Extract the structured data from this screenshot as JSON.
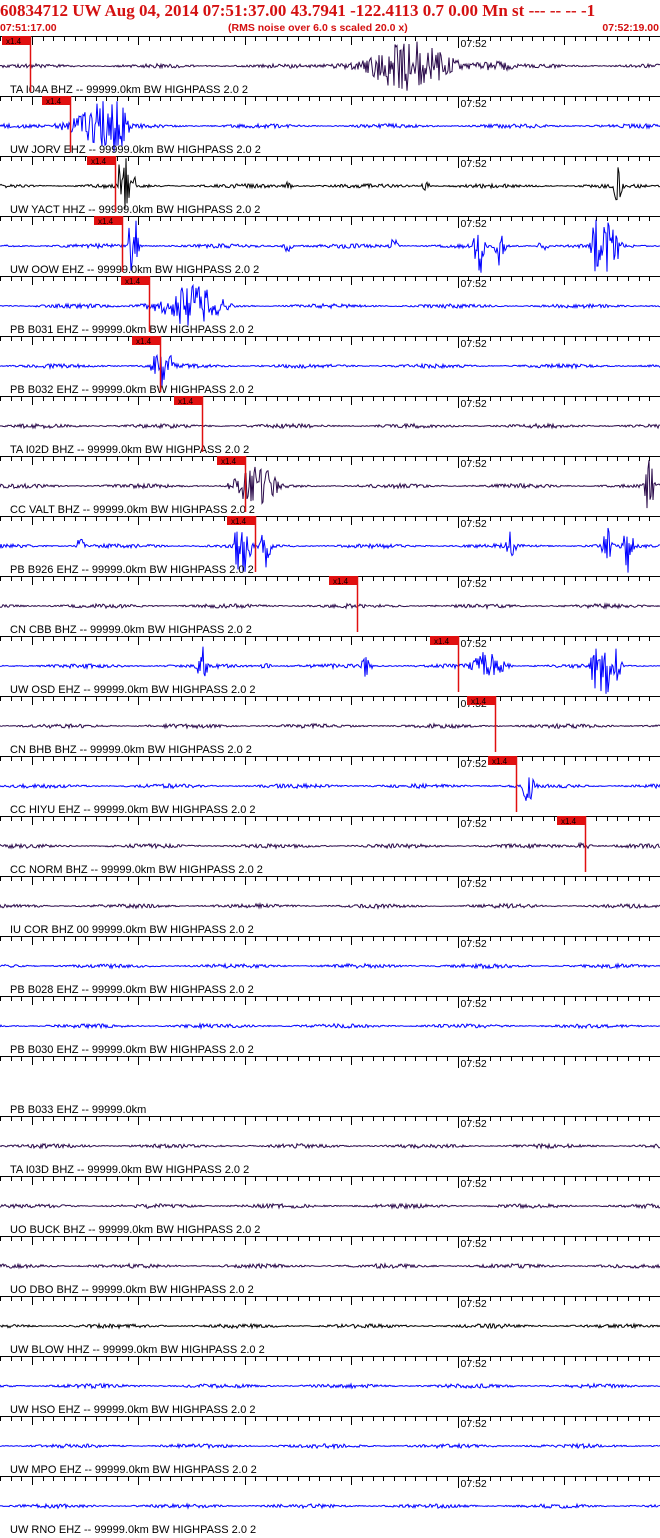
{
  "header": {
    "title": "60834712 UW Aug 04, 2014 07:51:37.00   43.7941 -122.4113  0.7 0.00 Mn st --- -- --   -1",
    "start_time": "07:51:17.00",
    "note": "(RMS noise over 6.0 s scaled 20.0 x)",
    "end_time": "07:52:19.00"
  },
  "chart_data": {
    "type": "line",
    "title": "60834712 UW Aug 04, 2014 07:51:37.00   43.7941 -122.4113  0.7 0.00 Mn st --- -- --   -1",
    "x_start": "07:51:17.00",
    "x_end": "07:52:19.00",
    "x_tick_label": "07:52",
    "pick_label": "x1.4",
    "traces": [
      {
        "label": "TA I04A BHZ -- 99999.0km BW  HIGHPASS  2.0  2",
        "color": "#2a0a4a",
        "pick_s": 2.8,
        "event": [
          30,
          60,
          3.2
        ],
        "spikes": []
      },
      {
        "label": "UW JORV EHZ -- 99999.0km BW  HIGHPASS  2.0  2",
        "color": "#0000ff",
        "pick_s": 6.6,
        "event": [
          5,
          17,
          7.0
        ],
        "spikes": []
      },
      {
        "label": "UW YACT HHZ -- 99999.0km BW  HIGHPASS  2.0  2",
        "color": "#000000",
        "pick_s": 10.8,
        "event": [
          11,
          14,
          9.0
        ],
        "spikes": [
          [
            27,
            0.9
          ],
          [
            40,
            1.5
          ],
          [
            58,
            1.4
          ]
        ]
      },
      {
        "label": "UW OOW EHZ -- 99999.0km BW  HIGHPASS  2.0  2",
        "color": "#0000ff",
        "pick_s": 11.5,
        "event": [
          12,
          14,
          1.5
        ],
        "spikes": [
          [
            12.5,
            2.2
          ],
          [
            27,
            2.5
          ],
          [
            37,
            2.0
          ],
          [
            45,
            3.0
          ],
          [
            47,
            2.5
          ],
          [
            51,
            2.5
          ],
          [
            56,
            3.0
          ],
          [
            57,
            3.0
          ],
          [
            58,
            3.0
          ]
        ]
      },
      {
        "label": "PB B031 EHZ -- 99999.0km BW  HIGHPASS  2.0  2",
        "color": "#0000ff",
        "pick_s": 14.0,
        "event": [
          12,
          28,
          2.8
        ],
        "spikes": []
      },
      {
        "label": "PB B032 EHZ -- 99999.0km BW  HIGHPASS  2.0  2",
        "color": "#0000ff",
        "pick_s": 15.0,
        "event": [
          14,
          18,
          3.0
        ],
        "spikes": []
      },
      {
        "label": "TA I02D BHZ -- 99999.0km BW  HIGHPASS  2.0  2",
        "color": "#2a0a4a",
        "pick_s": 19.0,
        "event": null,
        "spikes": []
      },
      {
        "label": "CC VALT BHZ -- 99999.0km BW  HIGHPASS  2.0  2",
        "color": "#2a0a4a",
        "pick_s": 23.0,
        "event": [
          21,
          30,
          2.5
        ],
        "spikes": [
          [
            61,
            2.5
          ],
          [
            63,
            2.0
          ]
        ]
      },
      {
        "label": "PB B926 EHZ -- 99999.0km BW  HIGHPASS  2.0  2",
        "color": "#0000ff",
        "pick_s": 24.0,
        "event": [
          22,
          25,
          2.0
        ],
        "spikes": [
          [
            7.5,
            1.8
          ],
          [
            22.5,
            2.0
          ],
          [
            25,
            2.2
          ],
          [
            48,
            1.5
          ],
          [
            57,
            1.8
          ],
          [
            59,
            2.0
          ]
        ]
      },
      {
        "label": "CN CBB BHZ -- 99999.0km BW  HIGHPASS  2.0  2",
        "color": "#2a0a4a",
        "pick_s": 33.5,
        "event": null,
        "spikes": []
      },
      {
        "label": "UW OSD EHZ -- 99999.0km BW  HIGHPASS  2.0  2",
        "color": "#0000ff",
        "pick_s": 43.0,
        "event": [
          44,
          51,
          2.5
        ],
        "spikes": [
          [
            19,
            1.8
          ],
          [
            25,
            1.8
          ],
          [
            34.5,
            2.5
          ],
          [
            56,
            3.0
          ],
          [
            57,
            3.0
          ],
          [
            58,
            3.0
          ]
        ]
      },
      {
        "label": "CN BHB BHZ -- 99999.0km BW  HIGHPASS  2.0  2",
        "color": "#2a0a4a",
        "pick_s": 46.5,
        "event": null,
        "spikes": []
      },
      {
        "label": "CC HIYU EHZ -- 99999.0km BW  HIGHPASS  2.0  2",
        "color": "#0000ff",
        "pick_s": 48.5,
        "event": [
          49,
          51,
          2.5
        ],
        "spikes": []
      },
      {
        "label": "CC NORM BHZ -- 99999.0km BW  HIGHPASS  2.0  2",
        "color": "#2a0a4a",
        "pick_s": 55.0,
        "event": [
          54,
          57,
          1.6
        ],
        "spikes": []
      },
      {
        "label": "IU COR BHZ 00 99999.0km BW  HIGHPASS  2.0  2",
        "color": "#2a0a4a",
        "pick_s": null,
        "event": null,
        "spikes": []
      },
      {
        "label": "PB B028 EHZ -- 99999.0km BW  HIGHPASS  2.0  2",
        "color": "#0000ff",
        "pick_s": null,
        "event": null,
        "spikes": []
      },
      {
        "label": "PB B030 EHZ -- 99999.0km BW  HIGHPASS  2.0  2",
        "color": "#0000ff",
        "pick_s": null,
        "event": null,
        "spikes": []
      },
      {
        "label": "PB B033 EHZ -- 99999.0km",
        "color": "#0000ff",
        "pick_s": null,
        "event": null,
        "spikes": [],
        "flat": true
      },
      {
        "label": "TA I03D BHZ -- 99999.0km BW  HIGHPASS  2.0  2",
        "color": "#2a0a4a",
        "pick_s": null,
        "event": null,
        "spikes": []
      },
      {
        "label": "UO BUCK BHZ -- 99999.0km BW  HIGHPASS  2.0  2",
        "color": "#2a0a4a",
        "pick_s": null,
        "event": null,
        "spikes": []
      },
      {
        "label": "UO DBO BHZ -- 99999.0km BW  HIGHPASS  2.0  2",
        "color": "#2a0a4a",
        "pick_s": null,
        "event": null,
        "spikes": []
      },
      {
        "label": "UW BLOW HHZ -- 99999.0km BW  HIGHPASS  2.0  2",
        "color": "#000000",
        "pick_s": null,
        "event": null,
        "spikes": []
      },
      {
        "label": "UW HSO EHZ -- 99999.0km BW  HIGHPASS  2.0  2",
        "color": "#0000ff",
        "pick_s": null,
        "event": null,
        "spikes": []
      },
      {
        "label": "UW MPO EHZ -- 99999.0km BW  HIGHPASS  2.0  2",
        "color": "#0000ff",
        "pick_s": null,
        "event": null,
        "spikes": []
      },
      {
        "label": "UW RNO EHZ -- 99999.0km BW  HIGHPASS  2.0  2",
        "color": "#0000ff",
        "pick_s": null,
        "event": null,
        "spikes": []
      }
    ]
  }
}
